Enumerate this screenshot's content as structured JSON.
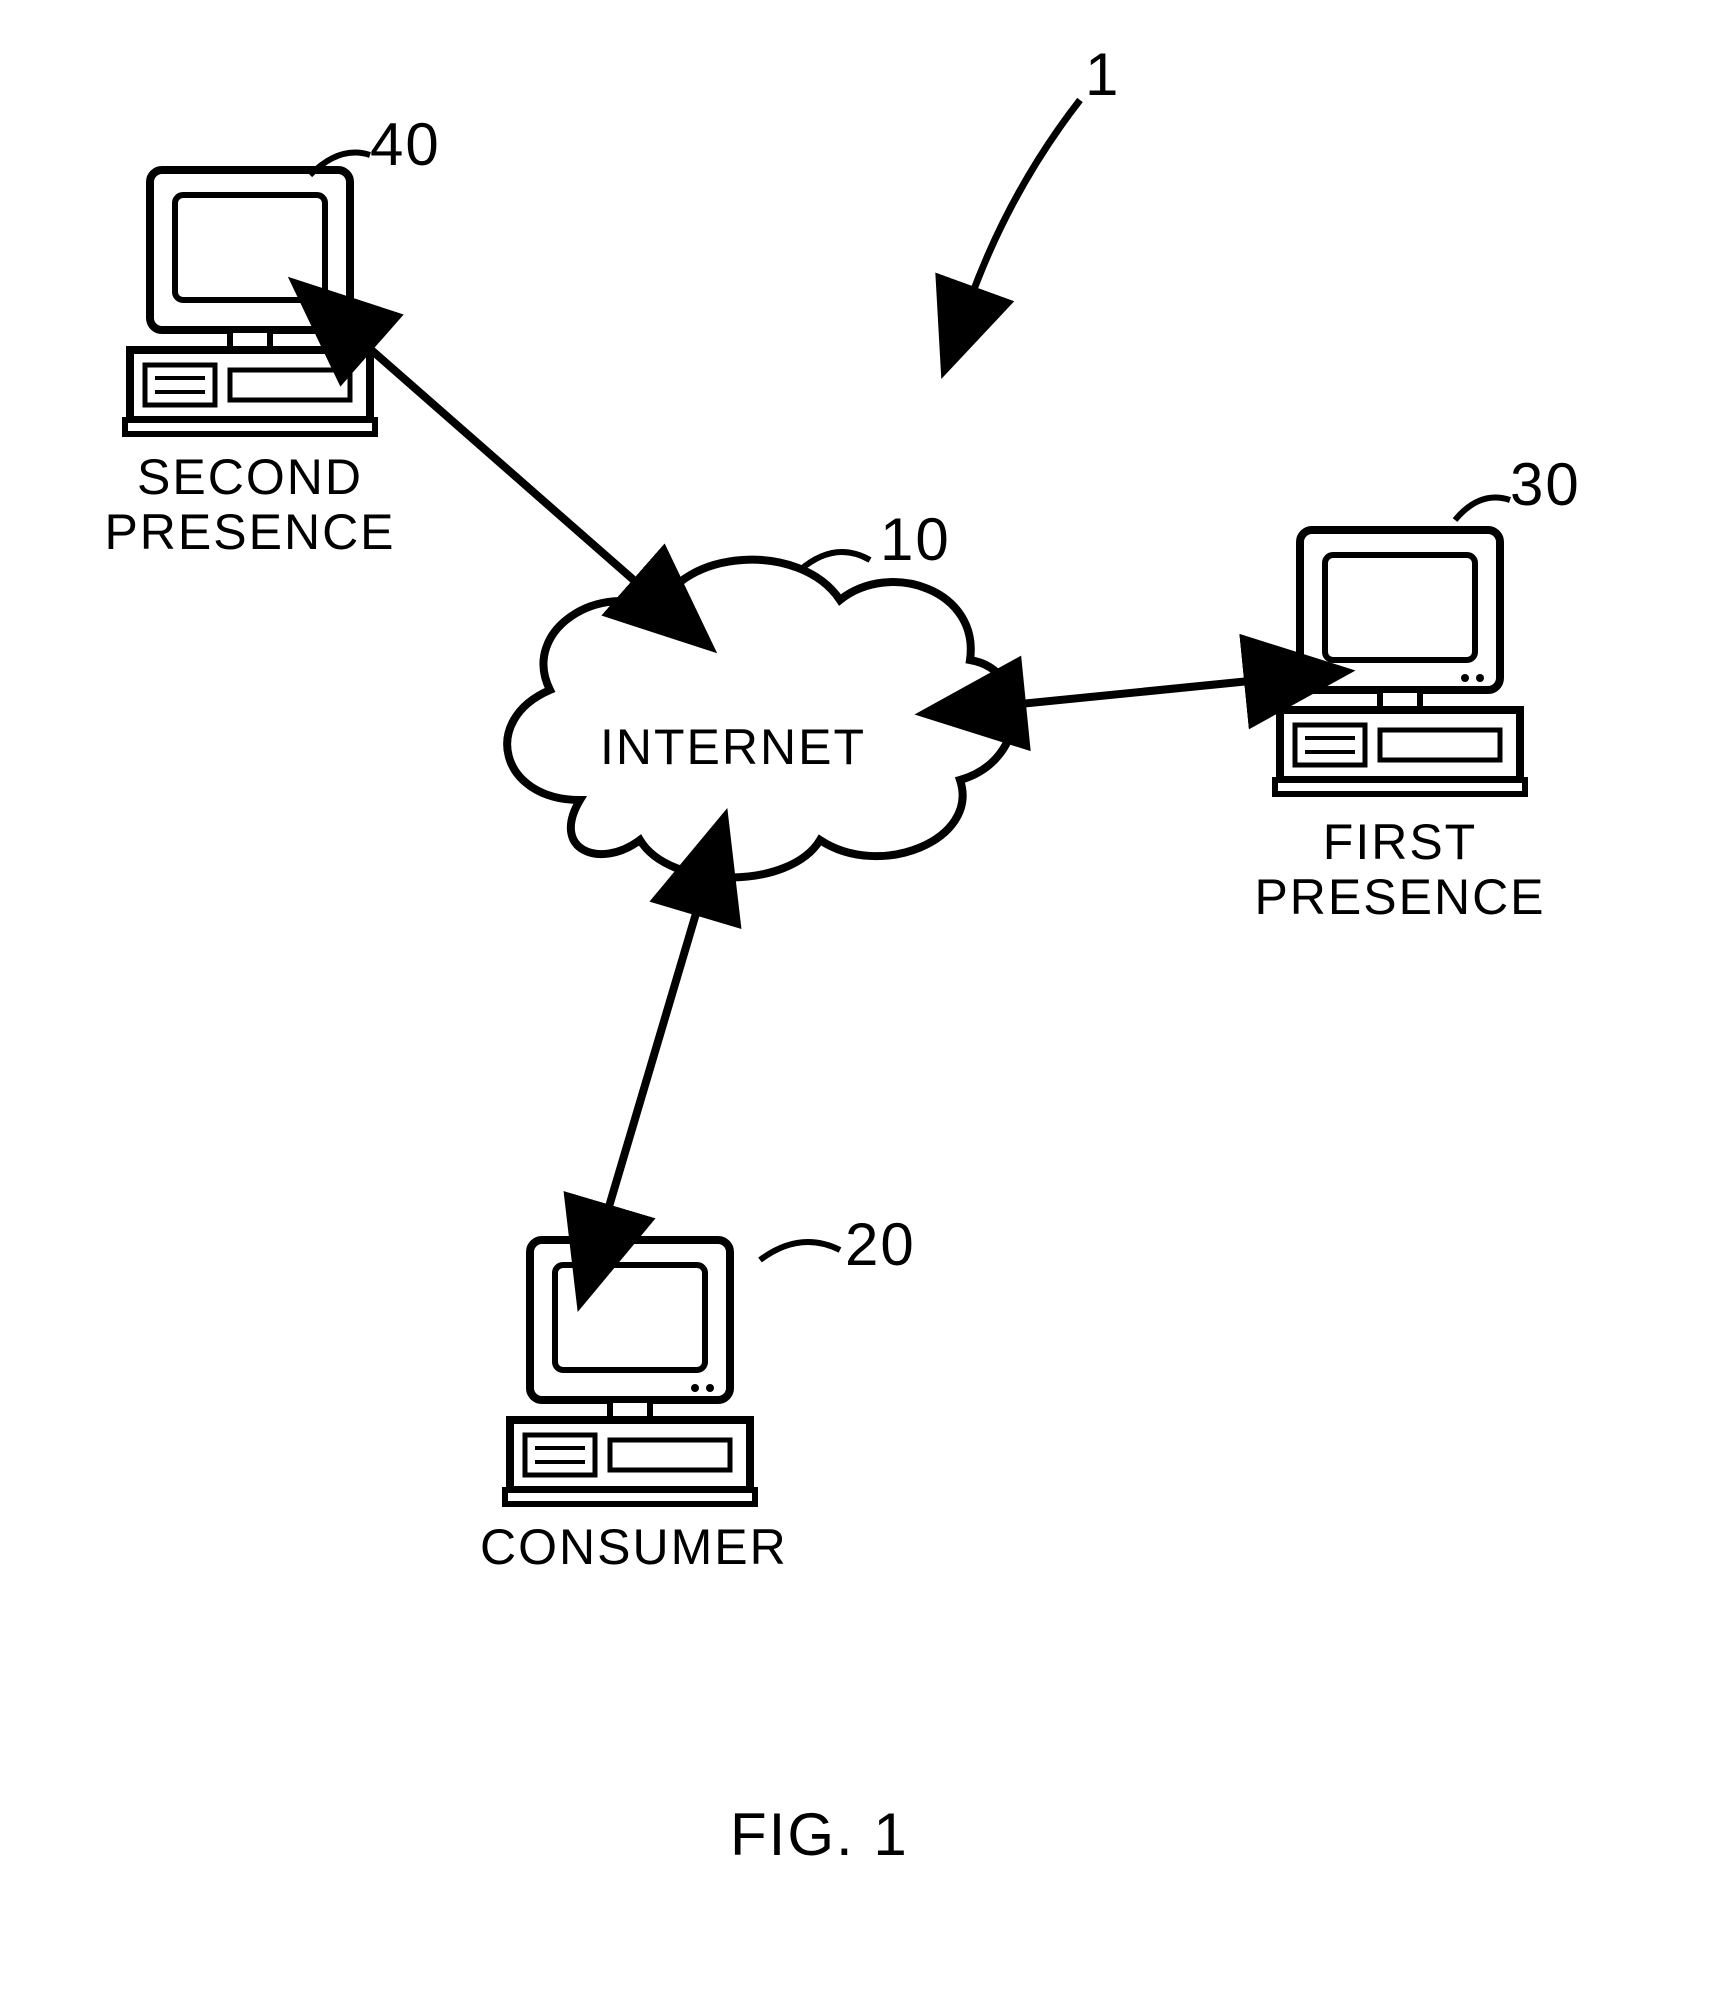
{
  "figure": {
    "caption": "FIG. 1",
    "ref_overall": "1",
    "cloud": {
      "label": "INTERNET",
      "ref": "10"
    },
    "nodes": {
      "consumer": {
        "label": "CONSUMER",
        "ref": "20"
      },
      "first_presence": {
        "label": "FIRST\nPRESENCE",
        "ref": "30"
      },
      "second_presence": {
        "label": "SECOND\nPRESENCE",
        "ref": "40"
      }
    }
  }
}
